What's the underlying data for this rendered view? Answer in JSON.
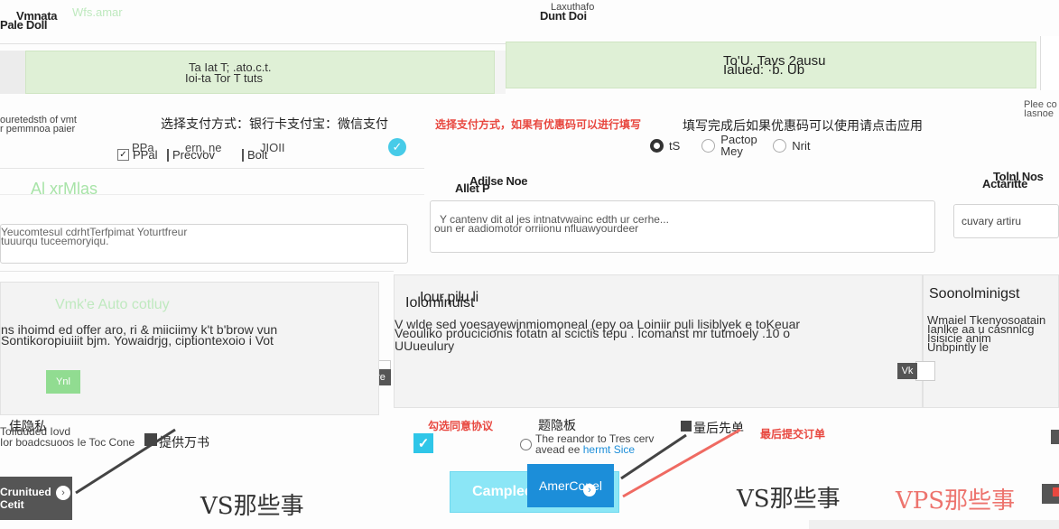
{
  "top_left": {
    "label_a": "Vmnata",
    "label_b": "Pale Doll",
    "ghost_text": "Wfs.amar"
  },
  "top_center": {
    "label_a": "Laxuthafo",
    "label_b": "Dunt Doi"
  },
  "left_bar": {
    "line1": "Ta Iat T; .ato.c.t.",
    "line2": "Ioi-ta Tor T tuts"
  },
  "right_bar": {
    "line1": "To'U. Tavs 2ausu",
    "line2": "Ialued: ·b. Ub"
  },
  "far_right_note": {
    "line1": "Plee co",
    "line2": "Iasnoe"
  },
  "left_desc": {
    "line1": "ouretedsth of vmt",
    "line2": "r pemmnoa paier"
  },
  "cn_heading": "选择支付方式：银行卡支付宝：微信支付",
  "red_note_1": "选择支付方式，如果有优惠码可以进行填写",
  "red_note_2": "填写完成后如果优惠码可以使用请点击应用",
  "pay_options": {
    "left": [
      {
        "label": "PPal",
        "checked": true
      },
      {
        "label": "Precvov",
        "checked": false
      },
      {
        "label": "Bolt",
        "checked": false
      }
    ],
    "left_top": [
      "PPa",
      "ern, ne",
      "JIOII"
    ],
    "right": [
      {
        "label": "tS",
        "on": true
      },
      {
        "label": "Pactop Mey",
        "on": false
      },
      {
        "label": "Nrit",
        "on": false
      }
    ]
  },
  "ghost_green_1": "Al xrMlas",
  "notes_section": {
    "title_a": "Adilse Noe",
    "title_b": "Allet P",
    "text": "Y cantenv dit al jes intnatvwainc edth ur cerhe...",
    "text2": "oun er aadiomotor orriionu nfluawyourdeer"
  },
  "right_heading": {
    "label_a": "Tolnl Nos",
    "label_b": "Actaritte"
  },
  "right_input_text": "cuvary artiru",
  "left_input_text": "Yeucomtesul cdrhtTerfpimat Yoturtfreur",
  "left_input_subtitle": "tuuurqu tuceemoryiqu.",
  "cart_header": "Vmk'e Auto cotluy",
  "middle_box": {
    "title_a": "Iour pilu li",
    "title_b": "Iolominuist",
    "p1": "V wlde sed yoesayewinmiomoneal (epy oa Loiniir puli lisiblyek e toKeuar",
    "p2": "Veouliko proucicionis fotatn al scictis tepu . Icomanst mr tutmoely .10 o",
    "p3": "UUueulury",
    "tab": "re"
  },
  "left_box": {
    "p1": "ns ihoimd ed offer aro, ri & miiciimy k't b'brow vun",
    "p2": "Sontikoropiuiiit bjm. Yowaidrjg, ciptiontexoio i Vot",
    "button": "Ynl"
  },
  "right_box": {
    "title": "Soonolminigst",
    "p1": "Wmaiel Tkenyosoatain",
    "p2": "Ianlke aa u casnnlcg",
    "p3": "Isisicie anim",
    "p4": "Unbpintly le",
    "tab": "Vk"
  },
  "bottom_left": {
    "cn_label": "佳隐私",
    "sub1": "ToIlduded Iovd",
    "sub2": "Ior boadcsuoos Ie Toc Cone",
    "check_label": "提供万书",
    "button": "Crunitued Cetit"
  },
  "agree": {
    "red": "勾选同意协议",
    "cn_label": "题隐板",
    "line1": "The reandor to Tres cerv",
    "line2": "avead ee ",
    "link": "hermt Sice"
  },
  "submit": {
    "cn_label": "量后先单",
    "red": "最后提交订单",
    "blue_button": "AmerConel",
    "cyan_button": "Campleet Optlinnt"
  },
  "watermarks": {
    "a": "VS那些事",
    "b": "VS那些事",
    "c": "VPS那些事"
  },
  "colors": {
    "accent_cyan": "#2fc6e8",
    "red_note": "#e8473f",
    "green_bar": "#dff0d6",
    "blue_button": "#1c8ed9"
  }
}
